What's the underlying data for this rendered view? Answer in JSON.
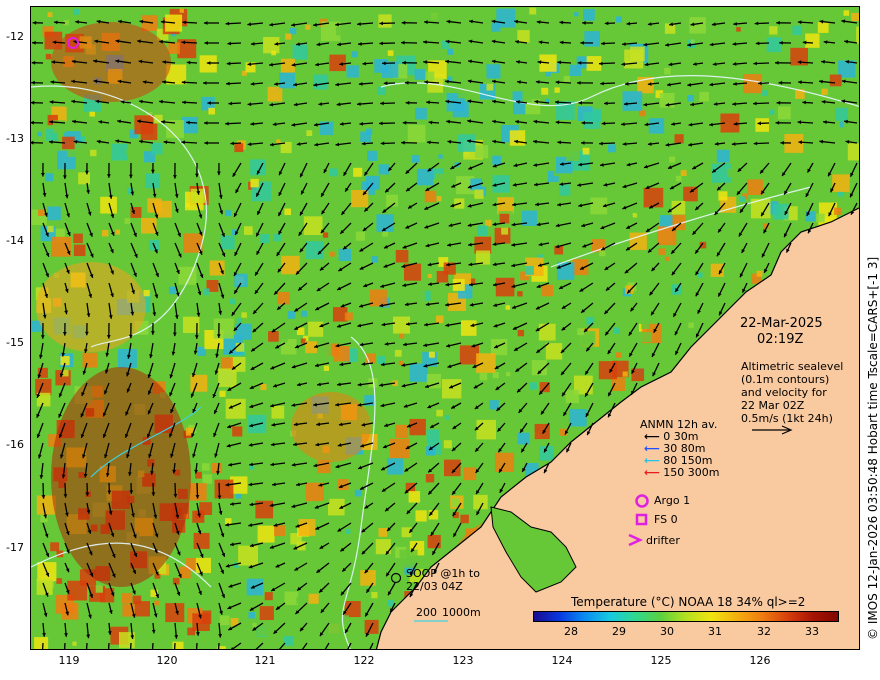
{
  "map": {
    "lon_ticks": [
      "119",
      "120",
      "121",
      "122",
      "123",
      "124",
      "125",
      "126"
    ],
    "lat_ticks": [
      "-12",
      "-13",
      "-14",
      "-15",
      "-16",
      "-17"
    ],
    "colors": {
      "land": "#f9c9a0",
      "ocean_warm": "#f2a11f",
      "ocean_mid": "#67c837",
      "ocean_cool": "#2bb4d6",
      "arrow": "#000000",
      "contour": "#e6f7ff"
    }
  },
  "date_block": {
    "date": "22-Mar-2025",
    "time": "02:19Z"
  },
  "altimetry": {
    "lines": [
      "Altimetric sealevel",
      "(0.1m contours)",
      "and velocity for",
      "22 Mar 02Z",
      "0.5m/s (1kt 24h)"
    ]
  },
  "anmn_legend": {
    "title": "ANMN 12h av.",
    "items": [
      {
        "label": "0 30m",
        "color": "#000000"
      },
      {
        "label": "30 80m",
        "color": "#1e50ff"
      },
      {
        "label": "80 150m",
        "color": "#22c4e8"
      },
      {
        "label": "150 300m",
        "color": "#e81c1c"
      }
    ]
  },
  "platforms": {
    "argo": "Argo 1",
    "fs": "FS 0",
    "drifter": "drifter",
    "marker_color": "#e020e0"
  },
  "soop": {
    "line1": "SOOP @1h to",
    "line2": "22/03 04Z"
  },
  "depth_legend": {
    "d200": "200",
    "d1000": "1000m",
    "color": "#40d0e0"
  },
  "colorbar": {
    "title": "Temperature (°C) NOAA 18 34% ql>=2",
    "ticks": [
      "28",
      "29",
      "30",
      "31",
      "32",
      "33"
    ],
    "colors": [
      "#1a0a8c",
      "#0838e0",
      "#0a8cf0",
      "#18c8e0",
      "#30d890",
      "#5cd040",
      "#b4e020",
      "#f0e410",
      "#f4b010",
      "#ef7d10",
      "#d8400c",
      "#a81406",
      "#800800"
    ]
  },
  "credit": "© IMOS 12-Jan-2026 03:50:48 Hobart time Tscale=CARS+[-1 3]"
}
